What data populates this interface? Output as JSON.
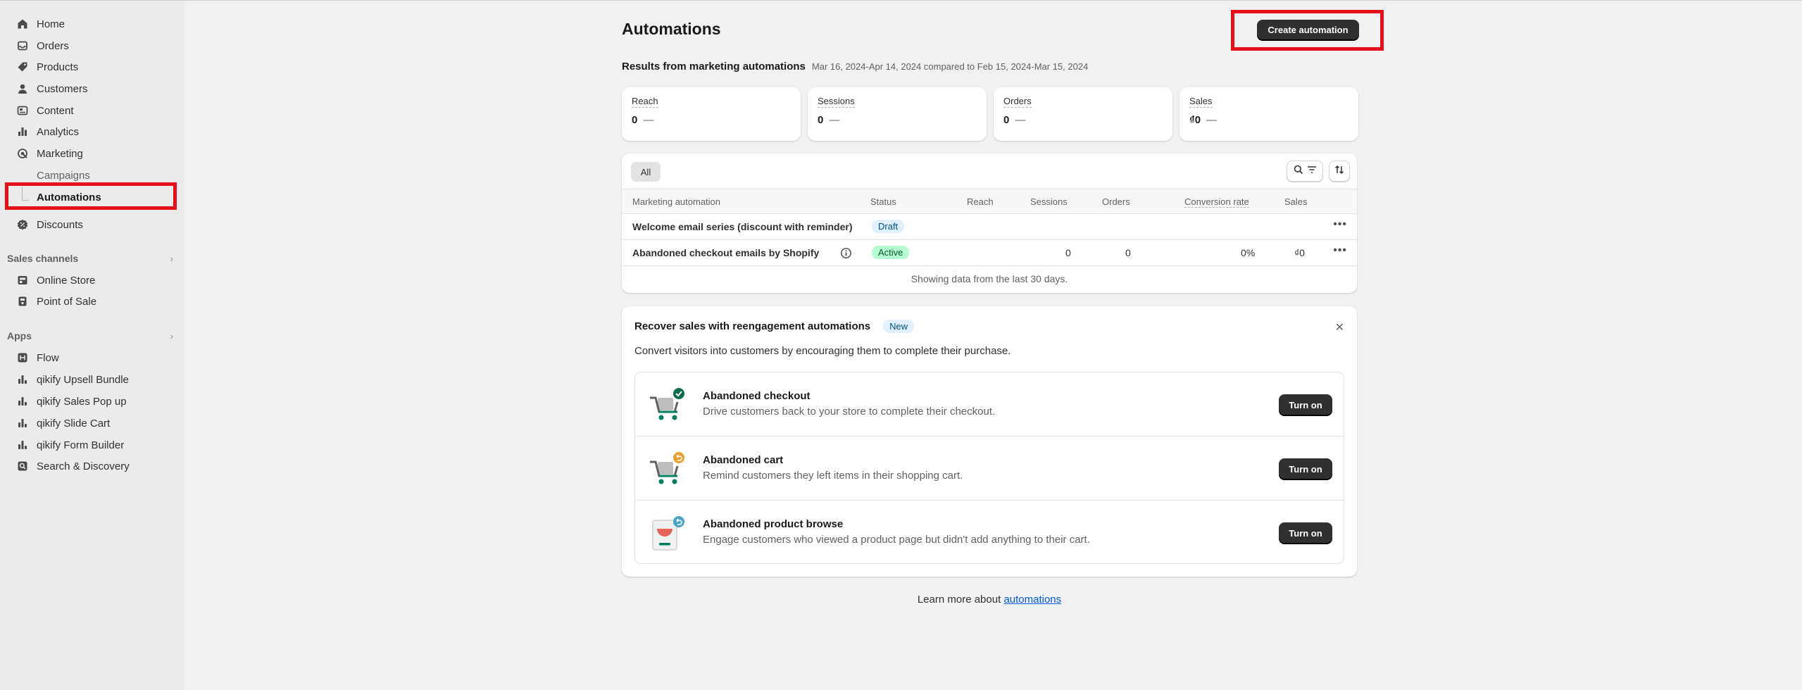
{
  "sidebar": {
    "items": [
      {
        "label": "Home",
        "icon": "home-icon"
      },
      {
        "label": "Orders",
        "icon": "inbox-icon"
      },
      {
        "label": "Products",
        "icon": "tag-icon"
      },
      {
        "label": "Customers",
        "icon": "person-icon"
      },
      {
        "label": "Content",
        "icon": "content-icon"
      },
      {
        "label": "Analytics",
        "icon": "bar-chart-icon"
      },
      {
        "label": "Marketing",
        "icon": "target-icon"
      }
    ],
    "marketing_sub": [
      {
        "label": "Campaigns"
      },
      {
        "label": "Automations"
      }
    ],
    "discounts": {
      "label": "Discounts",
      "icon": "discount-icon"
    },
    "sales_channels": {
      "heading": "Sales channels",
      "items": [
        {
          "label": "Online Store",
          "icon": "store-icon"
        },
        {
          "label": "Point of Sale",
          "icon": "pos-icon"
        }
      ]
    },
    "apps": {
      "heading": "Apps",
      "items": [
        {
          "label": "Flow",
          "icon": "flow-icon"
        },
        {
          "label": "qikify Upsell Bundle",
          "icon": "app-bars-icon"
        },
        {
          "label": "qikify Sales Pop up",
          "icon": "app-bars-icon"
        },
        {
          "label": "qikify Slide Cart",
          "icon": "app-bars-icon"
        },
        {
          "label": "qikify Form Builder",
          "icon": "app-bars-icon"
        },
        {
          "label": "Search & Discovery",
          "icon": "search-discovery-icon"
        }
      ]
    }
  },
  "header": {
    "title": "Automations",
    "create_button": "Create automation"
  },
  "results": {
    "title": "Results from marketing automations",
    "date_range": "Mar 16, 2024-Apr 14, 2024 compared to Feb 15, 2024-Mar 15, 2024"
  },
  "metrics": [
    {
      "label": "Reach",
      "value": "0",
      "change": "—"
    },
    {
      "label": "Sessions",
      "value": "0",
      "change": "—"
    },
    {
      "label": "Orders",
      "value": "0",
      "change": "—"
    },
    {
      "label": "Sales",
      "value": "₫0",
      "change": "—"
    }
  ],
  "table": {
    "tab_all": "All",
    "columns": [
      "Marketing automation",
      "Status",
      "Reach",
      "Sessions",
      "Orders",
      "Conversion rate",
      "Sales"
    ],
    "rows": [
      {
        "name": "Welcome email series (discount with reminder)",
        "status": "Draft",
        "reach": "",
        "sessions": "",
        "orders": "",
        "conversion": "",
        "sales": ""
      },
      {
        "name": "Abandoned checkout emails by Shopify",
        "status": "Active",
        "reach": "",
        "sessions": "0",
        "orders": "0",
        "conversion": "0%",
        "sales": "₫0"
      }
    ],
    "footnote": "Showing data from the last 30 days."
  },
  "promo": {
    "title": "Recover sales with reengagement automations",
    "badge": "New",
    "subtitle": "Convert visitors into customers by encouraging them to complete their purchase.",
    "items": [
      {
        "title": "Abandoned checkout",
        "description": "Drive customers back to your store to complete their checkout.",
        "button": "Turn on"
      },
      {
        "title": "Abandoned cart",
        "description": "Remind customers they left items in their shopping cart.",
        "button": "Turn on"
      },
      {
        "title": "Abandoned product browse",
        "description": "Engage customers who viewed a product page but didn't add anything to their cart.",
        "button": "Turn on"
      }
    ]
  },
  "learn_more": {
    "prefix": "Learn more about",
    "link": "automations"
  },
  "colors": {
    "highlight": "#e4111b",
    "primary_button": "#303030",
    "link": "#005bd3"
  }
}
